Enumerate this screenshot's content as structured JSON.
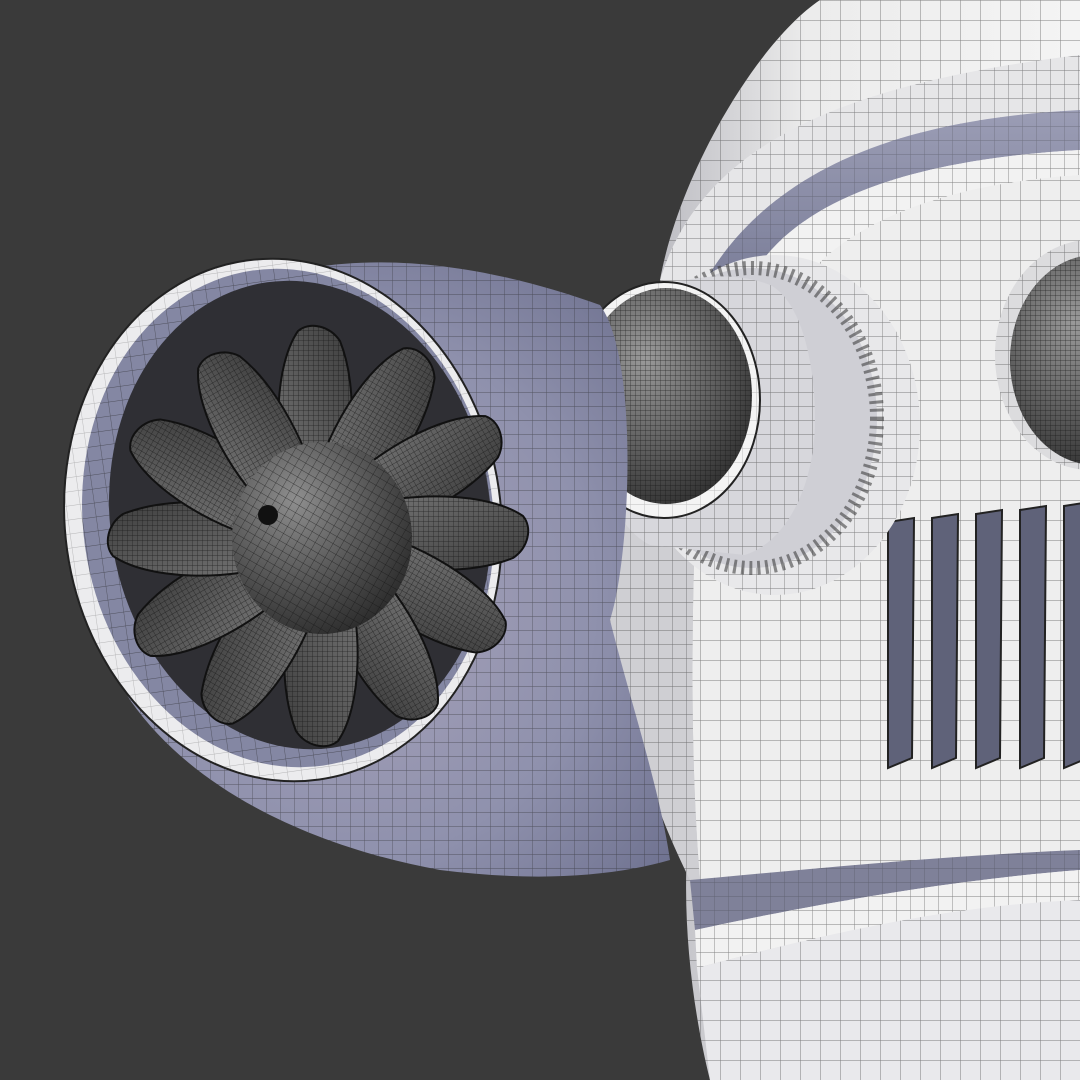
{
  "viewport": {
    "background": "#3a3a3a",
    "shading": "wireframe-on-shaded",
    "wire_color": "#1e1e1e",
    "surface_light": "#eeeeee",
    "surface_mid": "#cfcfd3",
    "surface_shadow": "#7d7f97",
    "cavity_color": "#2a2a2a"
  },
  "model": {
    "subject": "robot-head",
    "parts": [
      {
        "name": "head-dome",
        "icon": "dome"
      },
      {
        "name": "brow-ring",
        "icon": "torus"
      },
      {
        "name": "face-plate",
        "icon": "cylinder"
      },
      {
        "name": "jet-engine-ear",
        "icon": "turbine",
        "blade_count": 12
      },
      {
        "name": "eye-left",
        "icon": "sphere-in-socket"
      },
      {
        "name": "eye-right",
        "icon": "sphere-in-socket"
      },
      {
        "name": "mouth-grille",
        "icon": "grille",
        "slot_count": 5
      },
      {
        "name": "neck-collar",
        "icon": "ring"
      }
    ]
  }
}
